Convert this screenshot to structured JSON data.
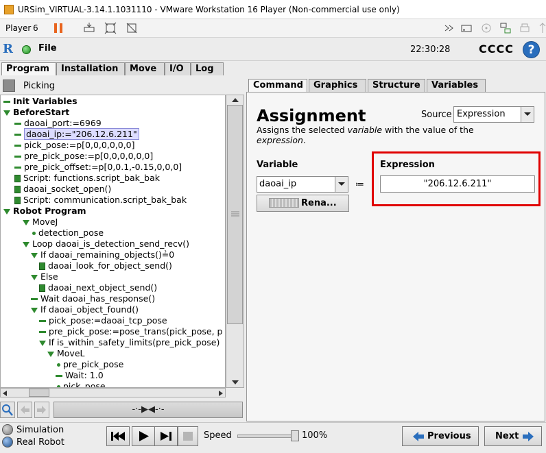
{
  "window": {
    "title": "URSim_VIRTUAL-3.14.1.1031110 - VMware Workstation 16 Player (Non-commercial use only)",
    "player_label": "Player",
    "player_caret": "6"
  },
  "header": {
    "file_menu": "File",
    "clock": "22:30:28",
    "robot_name": "CCCC",
    "help_glyph": "?"
  },
  "main_tabs": [
    {
      "label": "Program",
      "active": true
    },
    {
      "label": "Installation",
      "active": false
    },
    {
      "label": "Move",
      "active": false
    },
    {
      "label": "I/O",
      "active": false
    },
    {
      "label": "Log",
      "active": false
    }
  ],
  "program_name": "Picking",
  "tree": [
    {
      "text": "Init Variables",
      "icon": "dash",
      "indent": 0,
      "bold": true
    },
    {
      "text": "BeforeStart",
      "icon": "triangle",
      "indent": 0,
      "bold": true
    },
    {
      "text": "daoai_port:=6969",
      "icon": "dash",
      "indent": 1
    },
    {
      "text": "daoai_ip:=\"206.12.6.211\"",
      "icon": "dash",
      "indent": 1,
      "selected": true
    },
    {
      "text": "pick_pose:=p[0,0,0,0,0,0]",
      "icon": "dash",
      "indent": 1
    },
    {
      "text": "pre_pick_pose:=p[0,0,0,0,0,0]",
      "icon": "dash",
      "indent": 1
    },
    {
      "text": "pre_pick_offset:=p[0,0.1,-0.15,0,0,0]",
      "icon": "dash",
      "indent": 1
    },
    {
      "text": "Script: functions.script_bak_bak",
      "icon": "script",
      "indent": 1
    },
    {
      "text": "daoai_socket_open()",
      "icon": "script",
      "indent": 1
    },
    {
      "text": "Script: communication.script_bak_bak",
      "icon": "script",
      "indent": 1
    },
    {
      "text": "Robot Program",
      "icon": "triangle",
      "indent": 0,
      "bold": true
    },
    {
      "text": "MoveJ",
      "icon": "triangle",
      "indent": 2
    },
    {
      "text": "detection_pose",
      "icon": "dot",
      "indent": 3
    },
    {
      "text": "Loop daoai_is_detection_send_recv()",
      "icon": "triangle",
      "indent": 2
    },
    {
      "text": "If daoai_remaining_objects()≟0",
      "icon": "triangle",
      "indent": 3
    },
    {
      "text": "daoai_look_for_object_send()",
      "icon": "script",
      "indent": 4
    },
    {
      "text": "Else",
      "icon": "triangle",
      "indent": 3
    },
    {
      "text": "daoai_next_object_send()",
      "icon": "script",
      "indent": 4
    },
    {
      "text": "Wait daoai_has_response()",
      "icon": "dash",
      "indent": 3
    },
    {
      "text": "If daoai_object_found()",
      "icon": "triangle",
      "indent": 3
    },
    {
      "text": "pick_pose:=daoai_tcp_pose",
      "icon": "dash",
      "indent": 4
    },
    {
      "text": "pre_pick_pose:=pose_trans(pick_pose, p",
      "icon": "dash",
      "indent": 4
    },
    {
      "text": "If is_within_safety_limits(pre_pick_pose)",
      "icon": "triangle",
      "indent": 4
    },
    {
      "text": "MoveL",
      "icon": "triangle",
      "indent": 5
    },
    {
      "text": "pre_pick_pose",
      "icon": "dot",
      "indent": 6
    },
    {
      "text": "Wait: 1.0",
      "icon": "dash",
      "indent": 6
    },
    {
      "text": "pick_pose",
      "icon": "dot",
      "indent": 6
    }
  ],
  "tree_toolbar": {
    "drag_glyph": "-·-▶◀-·-"
  },
  "sub_tabs": [
    {
      "label": "Command",
      "active": true
    },
    {
      "label": "Graphics",
      "active": false
    },
    {
      "label": "Structure",
      "active": false
    },
    {
      "label": "Variables",
      "active": false
    }
  ],
  "assignment": {
    "title": "Assignment",
    "source_label": "Source",
    "source_value": "Expression",
    "desc_1": "Assigns the selected ",
    "desc_em_1": "variable",
    "desc_2": " with the value of the",
    "desc_em_2": "expression",
    "desc_3": ".",
    "variable_label": "Variable",
    "variable_value": "daoai_ip",
    "assign_operator": "≔",
    "rename_label": "Rena...",
    "expression_label": "Expression",
    "expression_value": "\"206.12.6.211\"",
    "highlight_color": "#e00000"
  },
  "bottom": {
    "simulation_label": "Simulation",
    "real_robot_label": "Real Robot",
    "speed_label": "Speed",
    "speed_value": "100%",
    "speed_fraction": 1.0,
    "previous_label": "Previous",
    "next_label": "Next"
  }
}
